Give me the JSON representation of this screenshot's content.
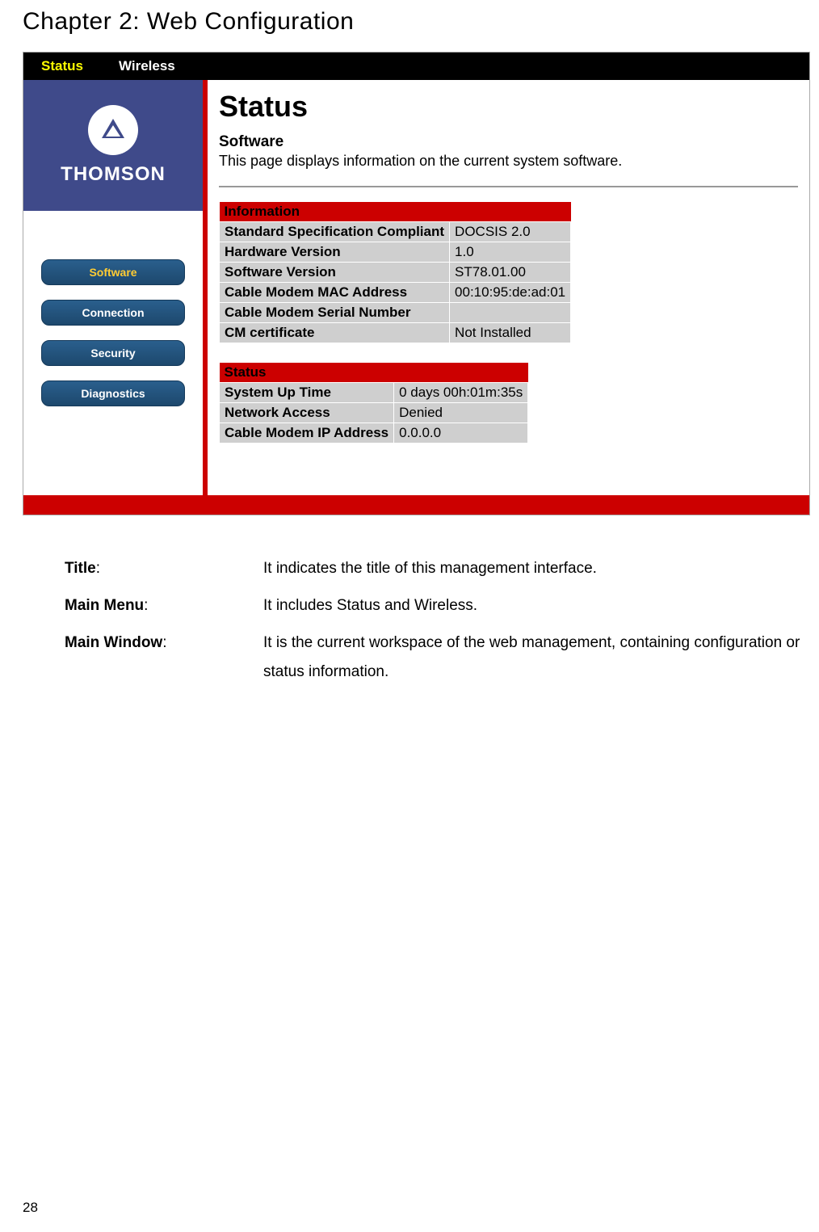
{
  "chapter_title": "Chapter 2: Web Configuration",
  "topbar": {
    "tabs": [
      {
        "label": "Status",
        "active": true
      },
      {
        "label": "Wireless",
        "active": false
      }
    ]
  },
  "logo": {
    "text": "THOMSON"
  },
  "sidenav": {
    "items": [
      {
        "label": "Software",
        "active": true
      },
      {
        "label": "Connection",
        "active": false
      },
      {
        "label": "Security",
        "active": false
      },
      {
        "label": "Diagnostics",
        "active": false
      }
    ]
  },
  "content": {
    "heading": "Status",
    "subhead": "Software",
    "description": "This page displays information on the current system software.",
    "tables": [
      {
        "title": "Information",
        "rows": [
          {
            "label": "Standard Specification Compliant",
            "value": "DOCSIS 2.0"
          },
          {
            "label": "Hardware Version",
            "value": "1.0"
          },
          {
            "label": "Software Version",
            "value": "ST78.01.00"
          },
          {
            "label": "Cable Modem MAC Address",
            "value": "00:10:95:de:ad:01"
          },
          {
            "label": "Cable Modem Serial Number",
            "value": ""
          },
          {
            "label": "CM certificate",
            "value": "Not Installed"
          }
        ]
      },
      {
        "title": "Status",
        "rows": [
          {
            "label": "System Up Time",
            "value": "0 days 00h:01m:35s"
          },
          {
            "label": "Network Access",
            "value": "Denied"
          },
          {
            "label": "Cable Modem IP Address",
            "value": "0.0.0.0"
          }
        ]
      }
    ]
  },
  "definitions": [
    {
      "term": "Title",
      "body": "It indicates the title of this management interface."
    },
    {
      "term": "Main Menu",
      "body": "It includes Status and Wireless."
    },
    {
      "term": "Main Window",
      "body": "It is the current workspace of the web management, containing configuration or status information."
    }
  ],
  "page_number": "28"
}
